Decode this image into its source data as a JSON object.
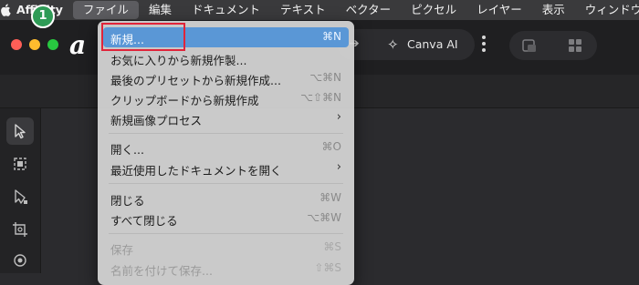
{
  "menubar": {
    "apple_icon": "apple-icon",
    "app_name": "Affinity",
    "items": [
      "ファイル",
      "編集",
      "ドキュメント",
      "テキスト",
      "ベクター",
      "ピクセル",
      "レイヤー",
      "表示",
      "ウィンドウ"
    ]
  },
  "annotation": {
    "step_badge": "1",
    "highlight_color": "#e0243a",
    "badge_color": "#2e9b56"
  },
  "toolbar": {
    "logo_text": "a",
    "canva_ai_label": "Canva AI",
    "canva_ai_icon": "sparkle-icon"
  },
  "file_menu": {
    "items": [
      {
        "label": "新規...",
        "shortcut": "⌘N"
      },
      {
        "label": "お気に入りから新規作製...",
        "shortcut": ""
      },
      {
        "label": "最後のプリセットから新規作成...",
        "shortcut": "⌥⌘N"
      },
      {
        "label": "クリップボードから新規作成",
        "shortcut": "⌥⇧⌘N"
      },
      {
        "label": "新規画像プロセス",
        "submenu": "›"
      },
      {
        "label": "開く...",
        "shortcut": "⌘O"
      },
      {
        "label": "最近使用したドキュメントを開く",
        "submenu": "›"
      },
      {
        "label": "閉じる",
        "shortcut": "⌘W"
      },
      {
        "label": "すべて閉じる",
        "shortcut": "⌥⌘W"
      },
      {
        "label": "保存",
        "shortcut": "⌘S"
      },
      {
        "label": "名前を付けて保存...",
        "shortcut": "⇧⌘S"
      }
    ]
  },
  "colors": {
    "menu_highlight": "#5a97d6",
    "background": "#2b2b2e"
  }
}
